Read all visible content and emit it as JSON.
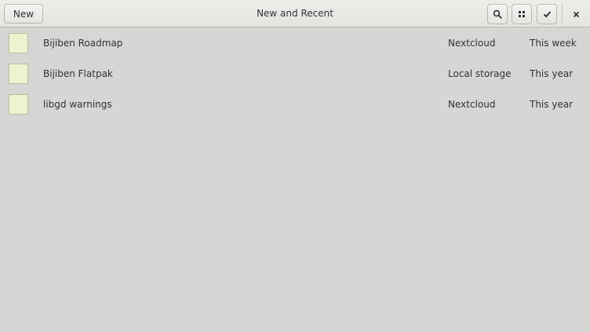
{
  "header": {
    "new_label": "New",
    "title": "New and Recent",
    "icons": {
      "search": "search-icon",
      "view": "grid-view-icon",
      "select": "check-icon",
      "close": "close-icon"
    }
  },
  "items": [
    {
      "title": "Bijiben Roadmap",
      "source": "Nextcloud",
      "date": "This week"
    },
    {
      "title": "Bijiben Flatpak",
      "source": "Local storage",
      "date": "This year"
    },
    {
      "title": "libgd warnings",
      "source": "Nextcloud",
      "date": "This year"
    }
  ],
  "colors": {
    "background": "#d6d6d4",
    "thumbnail": "#eef2cf",
    "text": "#2e3436"
  }
}
